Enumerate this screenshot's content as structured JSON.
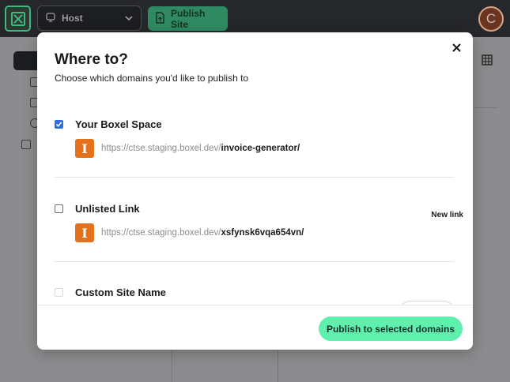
{
  "topbar": {
    "host_label": "Host",
    "publish_label": "Publish Site",
    "avatar_initial": "C"
  },
  "modal": {
    "title": "Where to?",
    "subtitle": "Choose which domains you'd like to publish to",
    "options": [
      {
        "label": "Your Boxel Space",
        "checked": true,
        "url_base": "https://ctse.staging.boxel.dev/",
        "url_path": "invoice-generator/",
        "icon_letter": "I"
      },
      {
        "label": "Unlisted Link",
        "checked": false,
        "url_base": "https://ctse.staging.boxel.dev/",
        "url_path": "xsfynsk6vqa654vn/",
        "icon_letter": "I",
        "badge": "New link"
      },
      {
        "label": "Custom Site Name",
        "checked": false
      }
    ],
    "publish_button": "Publish to selected domains"
  },
  "colors": {
    "brand_green": "#5ff0ae",
    "checkbox_blue": "#2f6fdc",
    "icon_orange": "#e4711b"
  }
}
